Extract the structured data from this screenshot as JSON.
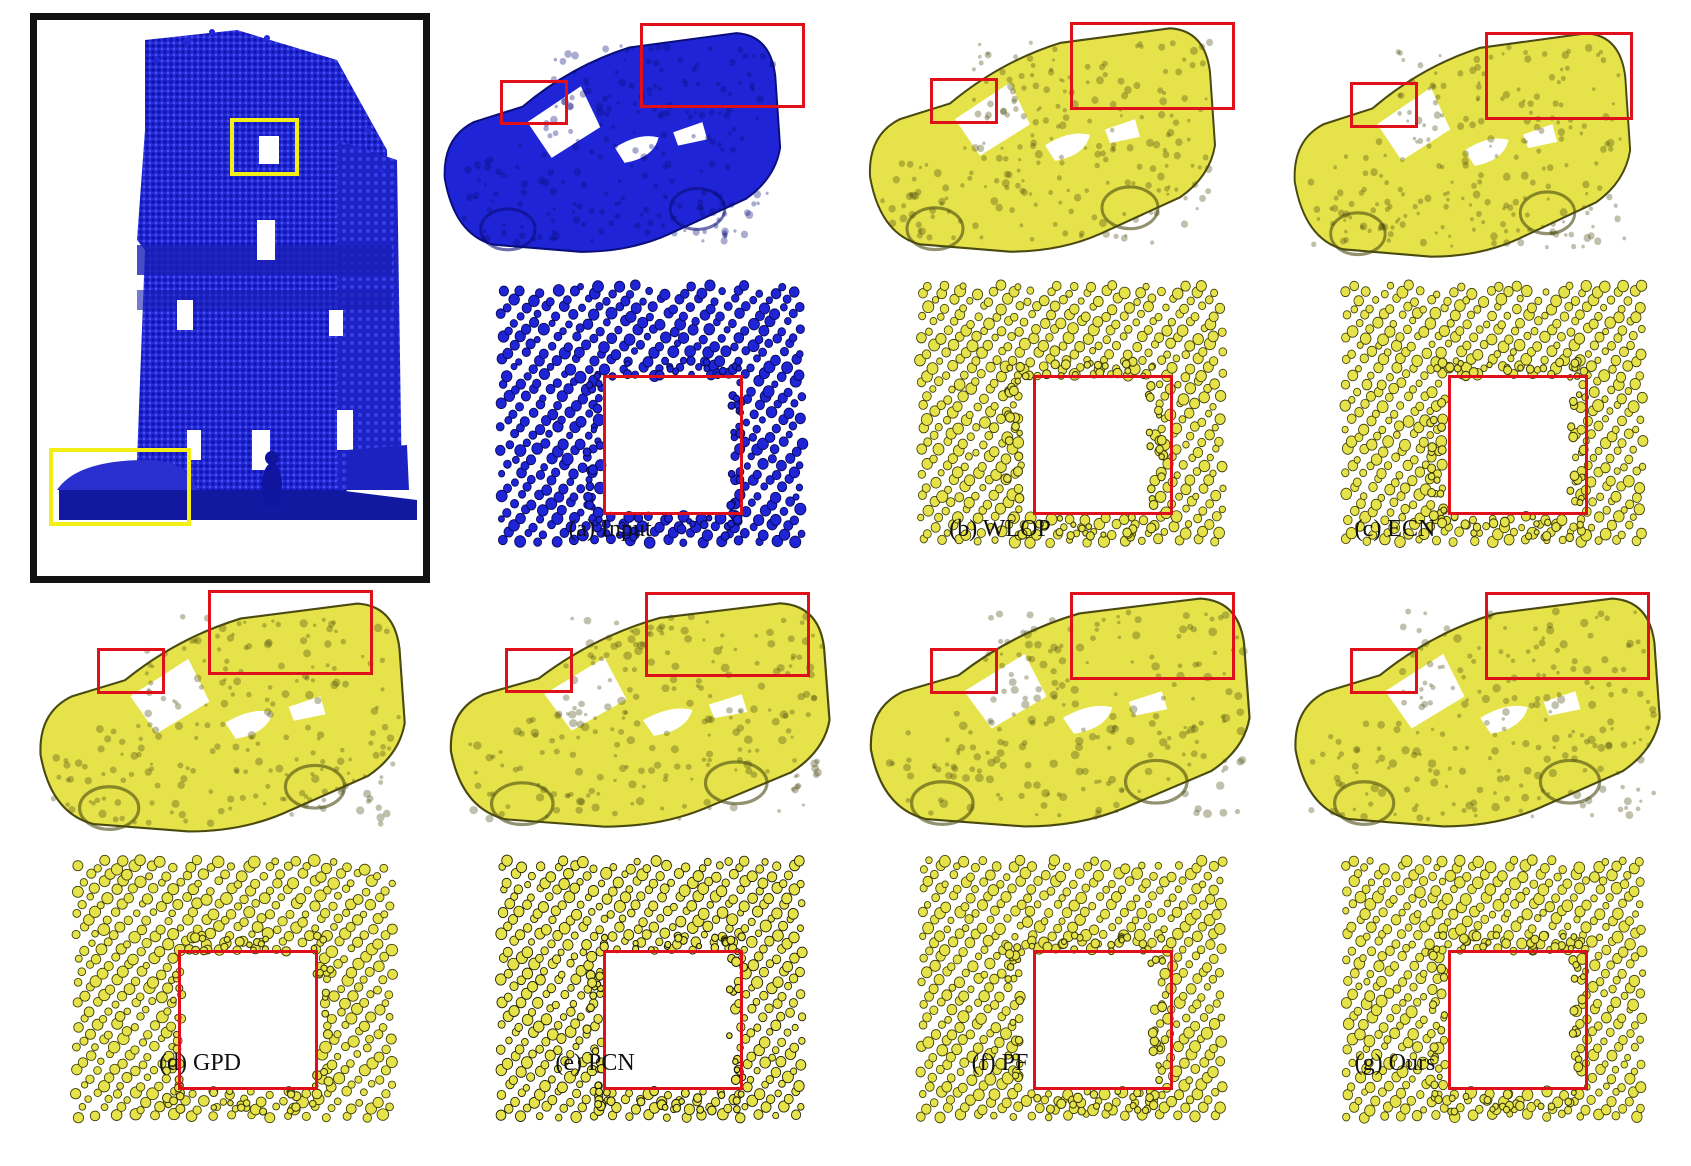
{
  "figure": {
    "captions": {
      "input": "(a) Input",
      "wlop": "(b) WLOP",
      "ecn": "(c) ECN",
      "gpd": "(d) GPD",
      "pcn": "(e) PCN",
      "pf": "(f) PF",
      "ours": "(g) Ours"
    },
    "colors": {
      "input_points": "#1f24d6",
      "result_points": "#e6e34a",
      "highlight_red": "#e0101a",
      "highlight_yellow": "#f2ee16",
      "frame": "#111111"
    }
  }
}
